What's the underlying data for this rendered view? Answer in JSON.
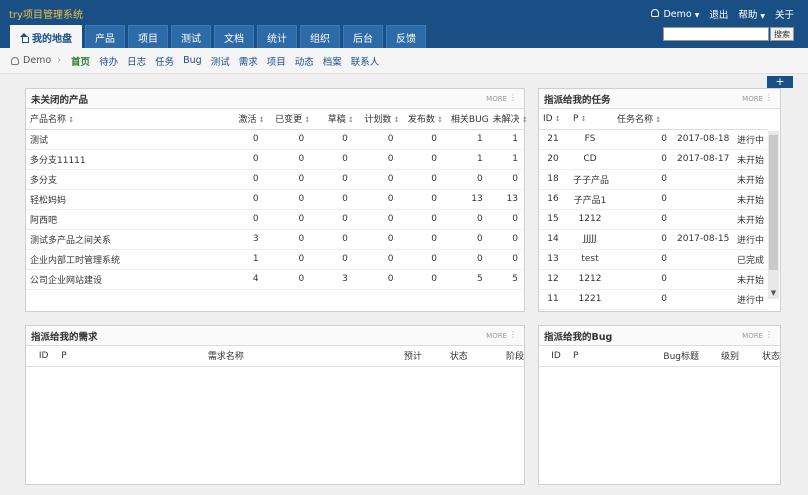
{
  "header": {
    "app_title": "try项目管理系统",
    "user": "Demo",
    "logout": "退出",
    "help": "帮助",
    "about": "关于",
    "tabs": [
      "我的地盘",
      "产品",
      "项目",
      "测试",
      "文档",
      "统计",
      "组织",
      "后台",
      "反馈"
    ],
    "search_button": "搜索"
  },
  "subnav": {
    "user": "Demo",
    "links": [
      "首页",
      "待办",
      "日志",
      "任务",
      "Bug",
      "测试",
      "需求",
      "项目",
      "动态",
      "档案",
      "联系人"
    ]
  },
  "add_button": "+",
  "products": {
    "title": "未关闭的产品",
    "more": "MORE",
    "columns": [
      "产品名称",
      "激活",
      "已变更",
      "草稿",
      "计划数",
      "发布数",
      "相关BUG",
      "未解决"
    ],
    "rows": [
      [
        "测试",
        "0",
        "0",
        "0",
        "0",
        "0",
        "1",
        "1"
      ],
      [
        "多分支11111",
        "0",
        "0",
        "0",
        "0",
        "0",
        "1",
        "1"
      ],
      [
        "多分支",
        "0",
        "0",
        "0",
        "0",
        "0",
        "0",
        "0"
      ],
      [
        "轻松妈妈",
        "0",
        "0",
        "0",
        "0",
        "0",
        "13",
        "13"
      ],
      [
        "阿西吧",
        "0",
        "0",
        "0",
        "0",
        "0",
        "0",
        "0"
      ],
      [
        "测试多产品之间关系",
        "3",
        "0",
        "0",
        "0",
        "0",
        "0",
        "0"
      ],
      [
        "企业内部工时管理系统",
        "1",
        "0",
        "0",
        "0",
        "0",
        "0",
        "0"
      ],
      [
        "公司企业网站建设",
        "4",
        "0",
        "3",
        "0",
        "0",
        "5",
        "5"
      ]
    ]
  },
  "tasks": {
    "title": "指派给我的任务",
    "more": "MORE",
    "columns": [
      "ID",
      "P",
      "任务名称",
      "",
      ""
    ],
    "rows": [
      [
        "21",
        "FS",
        "0",
        "2017-08-18",
        "进行中"
      ],
      [
        "20",
        "CD",
        "0",
        "2017-08-17",
        "未开始"
      ],
      [
        "18",
        "子子产品",
        "0",
        "",
        "未开始"
      ],
      [
        "16",
        "子产品1",
        "0",
        "",
        "未开始"
      ],
      [
        "15",
        "1212",
        "0",
        "",
        "未开始"
      ],
      [
        "14",
        "JJJJJ",
        "0",
        "2017-08-15",
        "进行中"
      ],
      [
        "13",
        "test",
        "0",
        "",
        "已完成"
      ],
      [
        "12",
        "1212",
        "0",
        "",
        "未开始"
      ],
      [
        "11",
        "1221",
        "0",
        "",
        "进行中"
      ]
    ]
  },
  "stories": {
    "title": "指派给我的需求",
    "more": "MORE",
    "columns": [
      "ID",
      "P",
      "需求名称",
      "预计",
      "状态",
      "阶段"
    ]
  },
  "bugs": {
    "title": "指派给我的Bug",
    "more": "MORE",
    "columns": [
      "ID",
      "P",
      "Bug标题",
      "级别",
      "状态"
    ]
  }
}
